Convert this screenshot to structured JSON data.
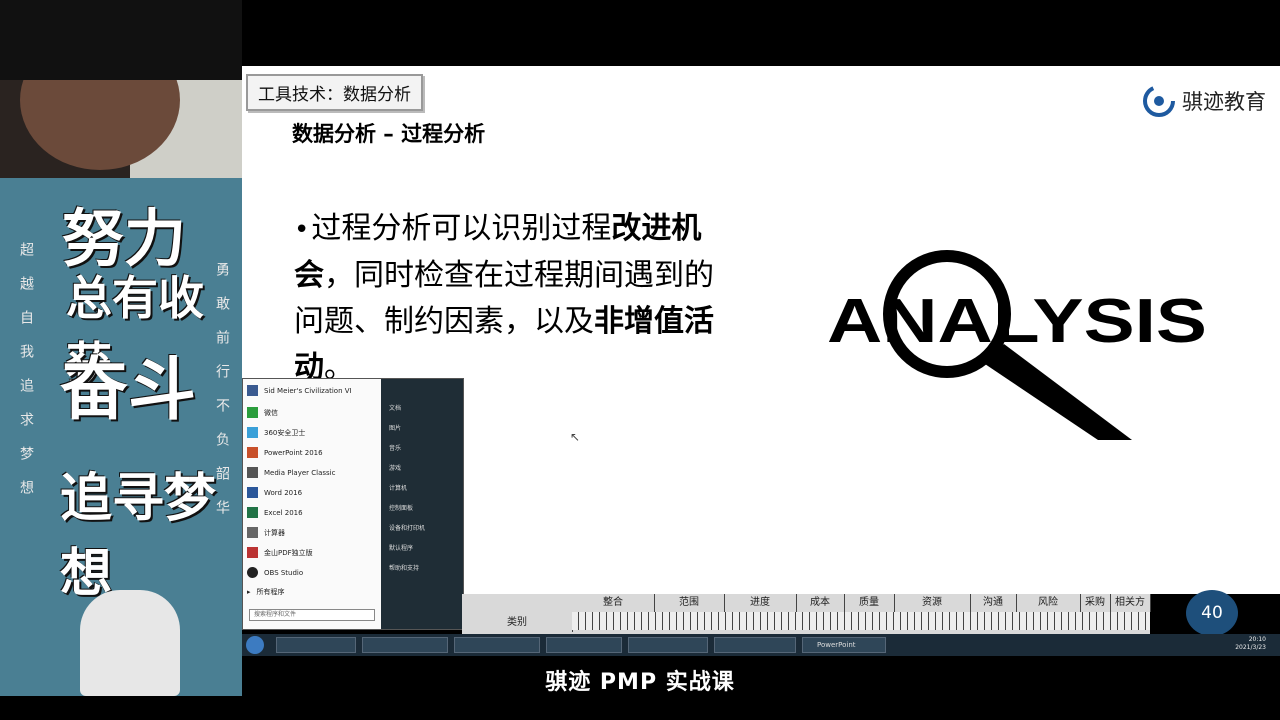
{
  "slide": {
    "section_label": "工具技术：数据分析",
    "brand_name": "骐迹教育",
    "title": "数据分析 – 过程分析",
    "bullet": {
      "t1": "过程分析可以识别过程",
      "b1": "改进机会",
      "t2": "，同时检查在过程期间遇到的问题、制约因素，以及",
      "b2": "非增值活动",
      "t3": "。"
    },
    "image_word": "ANALYSIS",
    "page_number": "40"
  },
  "poster": {
    "line1": "努力",
    "line2": "总有收获",
    "line3": "奋斗",
    "line4": "追寻梦想",
    "col_left": "超越自我追求梦想",
    "col_right": "勇敢前行不负韶华"
  },
  "start_menu": {
    "items": [
      "Sid Meier's Civilization VI",
      "微信",
      "360安全卫士",
      "PowerPoint 2016",
      "Media Player Classic",
      "Word 2016",
      "Excel 2016",
      "计算器",
      "金山PDF独立版",
      "OBS Studio",
      "所有程序"
    ],
    "right_items": [
      "文档",
      "图片",
      "音乐",
      "游戏",
      "计算机",
      "控制面板",
      "设备和打印机",
      "默认程序",
      "帮助和支持"
    ],
    "search_placeholder": "搜索程序和文件"
  },
  "sheet": {
    "label": "类别",
    "headers": [
      "整合",
      "范围",
      "进度",
      "成本",
      "质量",
      "资源",
      "沟通",
      "风险",
      "采购",
      "相关方"
    ]
  },
  "taskbar": {
    "buttons": [
      "",
      "",
      "",
      "",
      "",
      "",
      "",
      "PowerPoint",
      "",
      ""
    ],
    "time": "20:10",
    "date": "2021/3/23"
  },
  "caption": "骐迹 PMP 实战课",
  "colors": {
    "page_badge": "#1e4f7b",
    "poster_bg": "#4a7f93",
    "taskbar": "#1b2b38"
  }
}
